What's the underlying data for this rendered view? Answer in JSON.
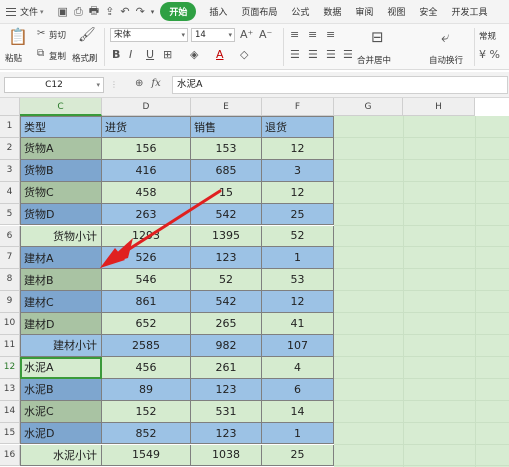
{
  "menubar": {
    "file_label": "文件",
    "tabs": [
      "开始",
      "插入",
      "页面布局",
      "公式",
      "数据",
      "审阅",
      "视图",
      "安全",
      "开发工具"
    ],
    "active_tab": "开始"
  },
  "ribbon": {
    "paste_label": "粘贴",
    "cut_label": "剪切",
    "copy_label": "复制",
    "format_painter_label": "格式刷",
    "font_name": "宋体",
    "font_size": "14",
    "merge_center_label": "合并居中",
    "auto_wrap_label": "自动换行",
    "number_format": "常规"
  },
  "formula_bar": {
    "name_box": "C12",
    "content": "水泥A"
  },
  "grid": {
    "columns": [
      "C",
      "D",
      "E",
      "F",
      "G",
      "H"
    ],
    "rows": [
      "1",
      "2",
      "3",
      "4",
      "5",
      "6",
      "7",
      "8",
      "9",
      "10",
      "11",
      "12",
      "13",
      "14",
      "15",
      "16"
    ],
    "data": [
      [
        "类型",
        "进货",
        "销售",
        "退货"
      ],
      [
        "货物A",
        "156",
        "153",
        "12"
      ],
      [
        "货物B",
        "416",
        "685",
        "3"
      ],
      [
        "货物C",
        "458",
        "15",
        "12"
      ],
      [
        "货物D",
        "263",
        "542",
        "25"
      ],
      [
        "货物小计",
        "1293",
        "1395",
        "52"
      ],
      [
        "建材A",
        "526",
        "123",
        "1"
      ],
      [
        "建材B",
        "546",
        "52",
        "53"
      ],
      [
        "建材C",
        "861",
        "542",
        "12"
      ],
      [
        "建材D",
        "652",
        "265",
        "41"
      ],
      [
        "建材小计",
        "2585",
        "982",
        "107"
      ],
      [
        "水泥A",
        "456",
        "261",
        "4"
      ],
      [
        "水泥B",
        "89",
        "123",
        "6"
      ],
      [
        "水泥C",
        "152",
        "531",
        "14"
      ],
      [
        "水泥D",
        "852",
        "123",
        "1"
      ],
      [
        "水泥小计",
        "1549",
        "1038",
        "25"
      ]
    ]
  },
  "colors": {
    "accent_green": "#2ea043",
    "cell_green": "#d5ebcf",
    "cell_blue": "#9cc2e5",
    "arrow_red": "#e02020"
  }
}
